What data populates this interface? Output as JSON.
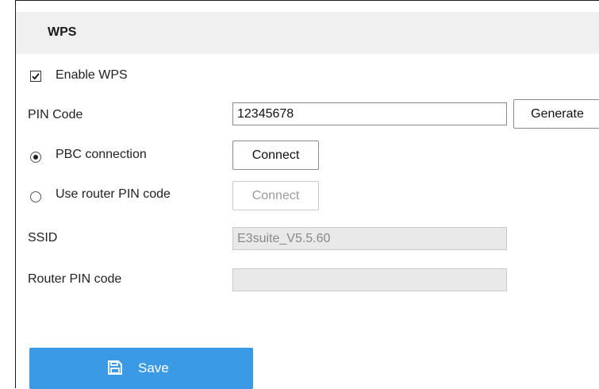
{
  "section": {
    "title": "WPS"
  },
  "enable_wps": {
    "label": "Enable WPS",
    "checked": true
  },
  "pin_code": {
    "label": "PIN Code",
    "value": "12345678",
    "generate_label": "Generate"
  },
  "pbc": {
    "label": "PBC connection",
    "selected": true,
    "connect_label": "Connect"
  },
  "router_pin": {
    "label": "Use router PIN code",
    "selected": false,
    "connect_label": "Connect"
  },
  "ssid": {
    "label": "SSID",
    "value": "E3suite_V5.5.60"
  },
  "router_pin_code": {
    "label": "Router PIN code",
    "value": ""
  },
  "save": {
    "label": "Save",
    "icon": "save-icon"
  },
  "colors": {
    "accent": "#3a9ae6",
    "header_bg": "#f0f0f0",
    "disabled_bg": "#e9e9e9"
  }
}
